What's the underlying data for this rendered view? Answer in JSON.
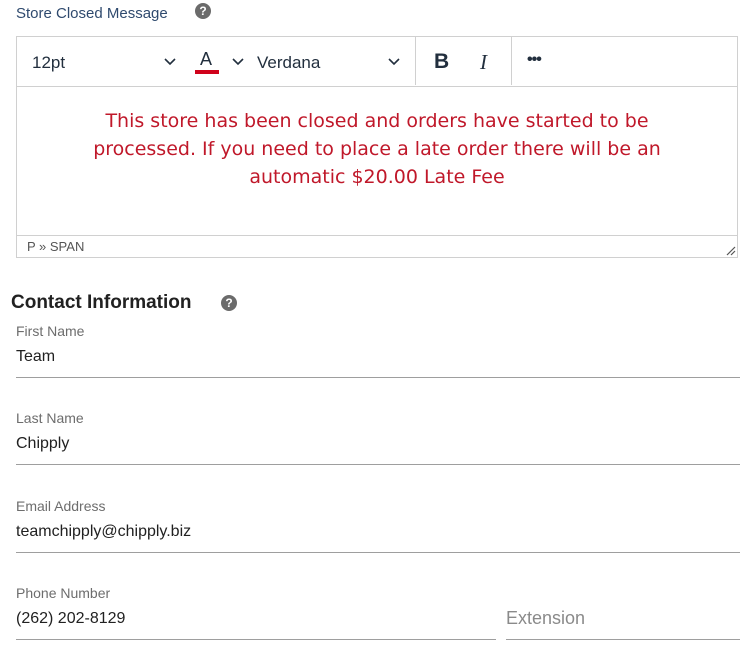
{
  "store_closed": {
    "label": "Store Closed Message",
    "help_icon": "question-circle-icon",
    "toolbar": {
      "font_size": "12pt",
      "text_color_glyph": "A",
      "text_color": "#d0021b",
      "font_family": "Verdana",
      "bold_glyph": "B",
      "italic_glyph": "I",
      "more_glyph": "•••"
    },
    "message": "This store has been closed and orders have started to be processed. If you need to place a late order there will be an automatic $20.00 Late Fee",
    "message_color": "#c0182a",
    "path": "P » SPAN"
  },
  "contact": {
    "heading": "Contact Information",
    "help_icon": "question-circle-icon",
    "first_name": {
      "label": "First Name",
      "value": "Team"
    },
    "last_name": {
      "label": "Last Name",
      "value": "Chipply"
    },
    "email": {
      "label": "Email Address",
      "value": "teamchipply@chipply.biz"
    },
    "phone": {
      "label": "Phone Number",
      "value": "(262) 202-8129"
    },
    "extension": {
      "placeholder": "Extension"
    }
  }
}
